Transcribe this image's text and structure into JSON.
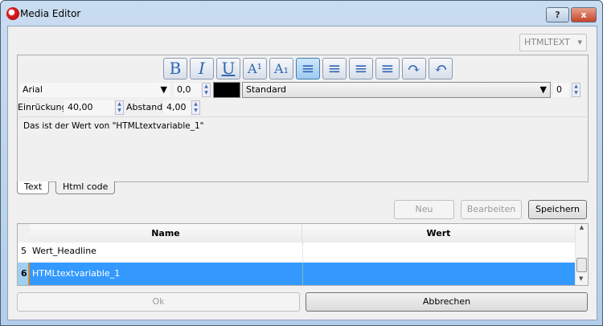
{
  "window": {
    "title": "Media Editor",
    "help": "?",
    "close": "x"
  },
  "type_combo": "HTMLTEXT",
  "toolbar": [
    {
      "name": "bold",
      "glyph": "B"
    },
    {
      "name": "italic",
      "glyph": "I"
    },
    {
      "name": "underline",
      "glyph": "U"
    },
    {
      "name": "superscript",
      "glyph": "A¹"
    },
    {
      "name": "subscript",
      "glyph": "A₁"
    },
    {
      "name": "align-left",
      "glyph": "≡"
    },
    {
      "name": "align-center",
      "glyph": "≡"
    },
    {
      "name": "justify",
      "glyph": "≡"
    },
    {
      "name": "align-right",
      "glyph": "≡"
    },
    {
      "name": "undo",
      "glyph": "↷"
    },
    {
      "name": "redo",
      "glyph": "↶"
    }
  ],
  "font": {
    "family": "Arial",
    "size": "0,0",
    "color": "#000000",
    "style": "Standard",
    "style_value": "0"
  },
  "indent": {
    "label": "Einrückung:",
    "value": "40,00"
  },
  "spacing": {
    "label": "Abstand:",
    "value": "4,00"
  },
  "editor_text": "Das ist der Wert von \"HTMLtextvariable_1\"",
  "tabs": [
    {
      "label": "Text",
      "active": true
    },
    {
      "label": "Html code",
      "active": false
    }
  ],
  "actions": {
    "new": "Neu",
    "edit": "Bearbeiten",
    "save": "Speichern"
  },
  "table": {
    "headers": [
      "Name",
      "Wert"
    ],
    "rows": [
      {
        "index": "5",
        "name": "Wert_Headline",
        "value": ""
      },
      {
        "index": "6",
        "name": "HTMLtextvariable_1",
        "value": "",
        "selected": true
      }
    ]
  },
  "footer": {
    "ok": "Ok",
    "cancel": "Abbrechen"
  }
}
